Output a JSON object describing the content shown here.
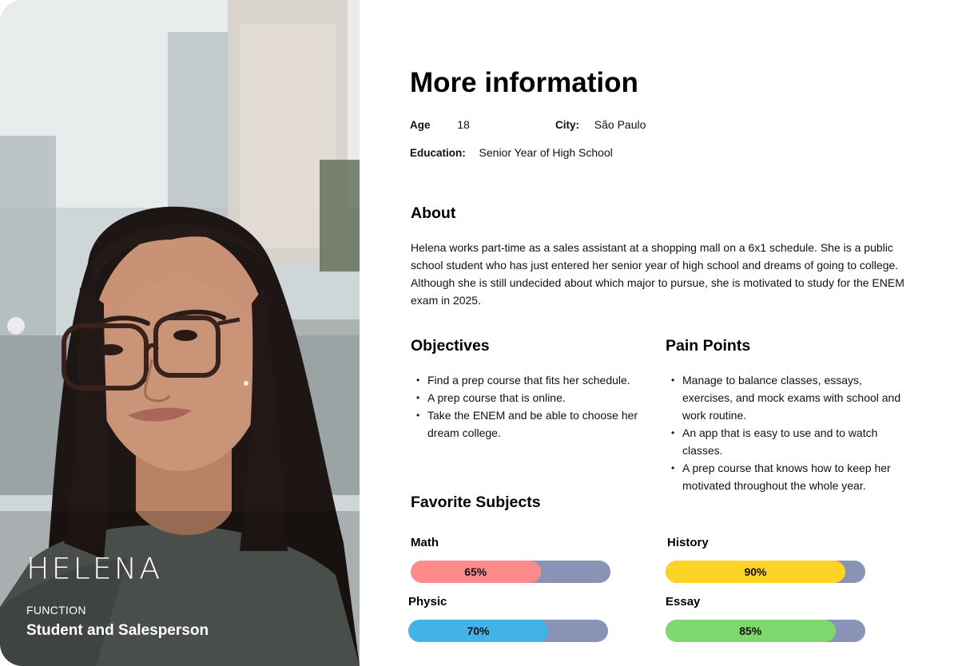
{
  "persona": {
    "name": "HELENA",
    "function_label": "FUNCTION",
    "function_value": "Student and Salesperson"
  },
  "info": {
    "title": "More information",
    "age_label": "Age",
    "age_value": "18",
    "city_label": "City:",
    "city_value": "São Paulo",
    "education_label": "Education:",
    "education_value": "Senior Year of High School"
  },
  "about": {
    "heading": "About",
    "text": "Helena works part-time as a sales assistant at a shopping mall on a 6x1 schedule. She is a public school student who has just entered her senior year of high school and dreams of going to college. Although she is still undecided about which major to pursue, she is motivated to study for the ENEM exam in 2025."
  },
  "objectives": {
    "heading": "Objectives",
    "items": [
      "Find a prep course that fits her schedule.",
      "A prep course that is online.",
      "Take the ENEM and be able to choose her dream college."
    ]
  },
  "pain_points": {
    "heading": "Pain Points",
    "items": [
      "Manage to balance classes, essays, exercises, and mock exams with school and work routine.",
      "An app that is easy to use and to watch classes.",
      "A prep course that knows how to keep her motivated throughout the whole year."
    ]
  },
  "favorite_subjects": {
    "heading": "Favorite Subjects",
    "track_color": "#8893b6",
    "subjects": [
      {
        "name": "Math",
        "label": "65%",
        "value": 0.65,
        "color": "#fd8b8b"
      },
      {
        "name": "History",
        "label": "90%",
        "value": 0.9,
        "color": "#fdd326"
      },
      {
        "name": "Physic",
        "label": "70%",
        "value": 0.7,
        "color": "#42b3e6"
      },
      {
        "name": "Essay",
        "label": "85%",
        "value": 0.85,
        "color": "#7ed86d"
      }
    ]
  }
}
